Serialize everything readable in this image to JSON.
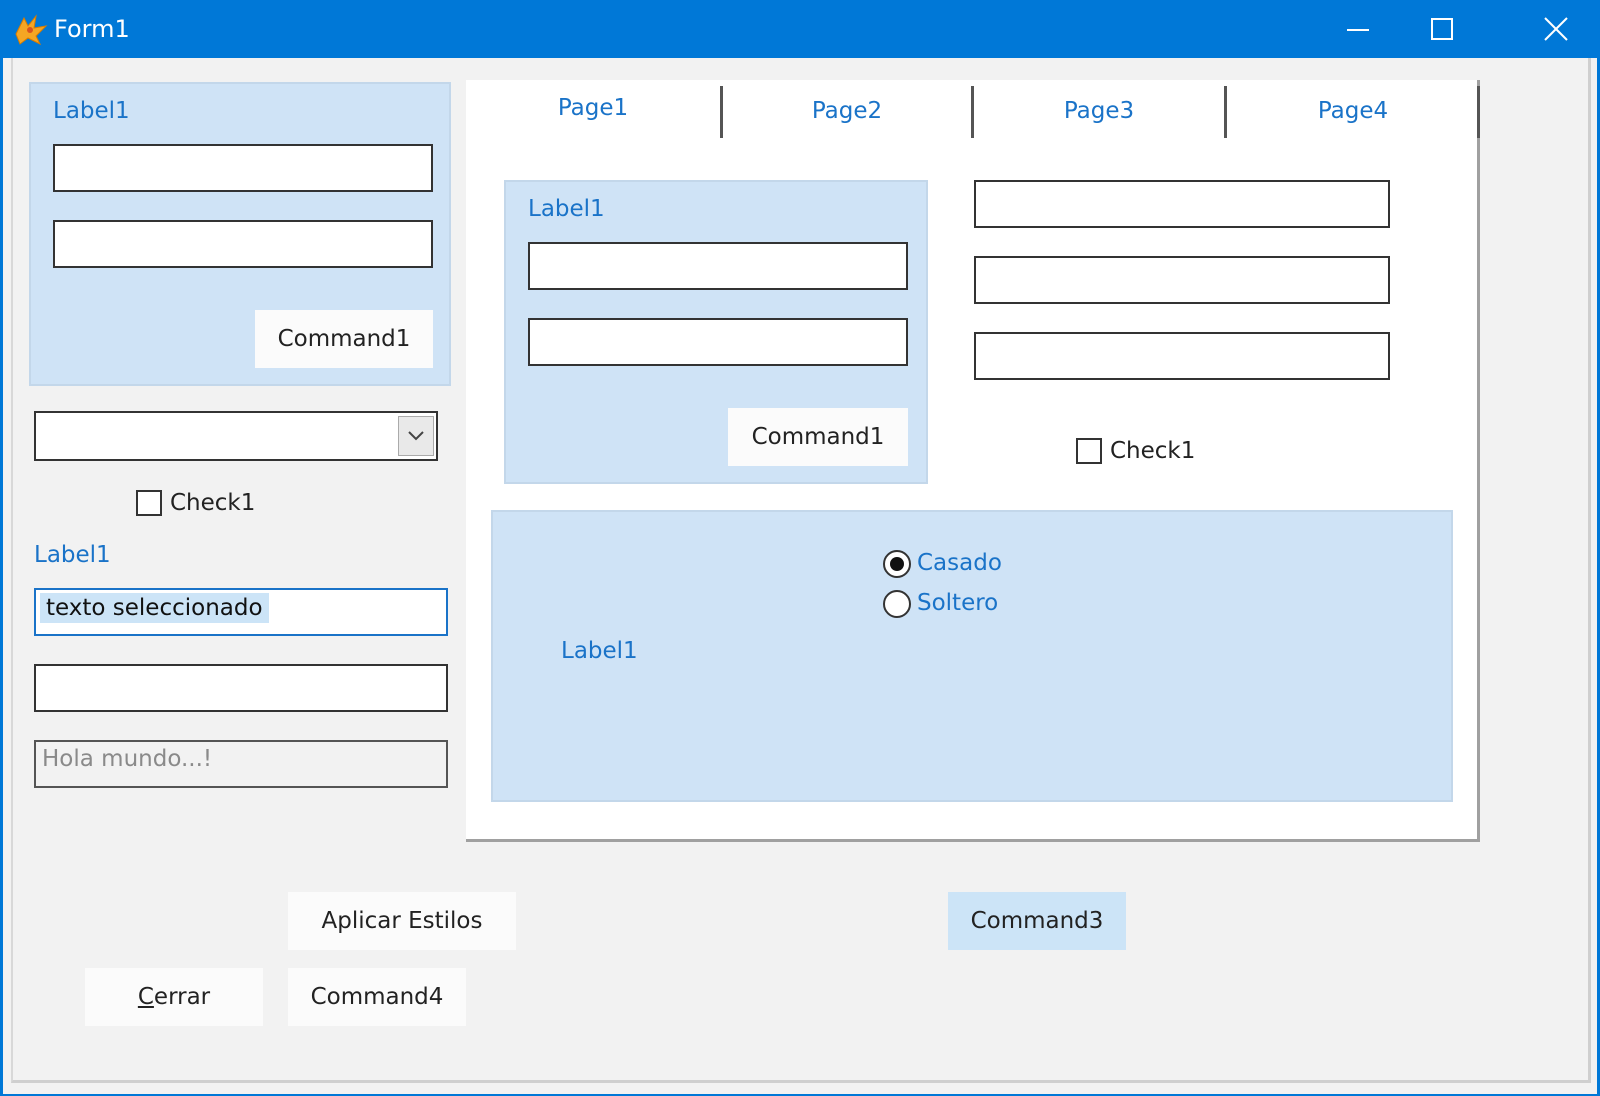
{
  "window": {
    "title": "Form1",
    "minimize_icon": "minimize-icon",
    "maximize_icon": "maximize-icon",
    "close_icon": "close-icon"
  },
  "left_panel": {
    "label": "Label1",
    "textbox1": "",
    "textbox2": "",
    "command": "Command1"
  },
  "combo": {
    "value": "",
    "icon": "chevron-down-icon"
  },
  "left_check": {
    "label": "Check1",
    "checked": false
  },
  "left_label": "Label1",
  "selected_text": {
    "value": "texto seleccionado"
  },
  "textbox_empty": "",
  "disabled_text": {
    "value": "Hola mundo...!"
  },
  "pageframe": {
    "tabs": [
      {
        "label": "Page1",
        "active": true
      },
      {
        "label": "Page2",
        "active": false
      },
      {
        "label": "Page3",
        "active": false
      },
      {
        "label": "Page4",
        "active": false
      }
    ],
    "inner_panel": {
      "label": "Label1",
      "textbox1": "",
      "textbox2": "",
      "command": "Command1"
    },
    "right_textboxes": [
      "",
      "",
      ""
    ],
    "check": {
      "label": "Check1",
      "checked": false
    },
    "option_panel": {
      "options": [
        {
          "label": "Casado",
          "selected": true
        },
        {
          "label": "Soltero",
          "selected": false
        }
      ],
      "label": "Label1"
    }
  },
  "buttons": {
    "apply_styles": "Aplicar Estilos",
    "command3": "Command3",
    "close_prefix": "C",
    "close_rest": "errar",
    "command4": "Command4"
  },
  "colors": {
    "title_bar": "#0078d7",
    "label_blue": "#1a73c8",
    "panel_blue": "#cfe3f6",
    "selection": "#cce4f7"
  }
}
